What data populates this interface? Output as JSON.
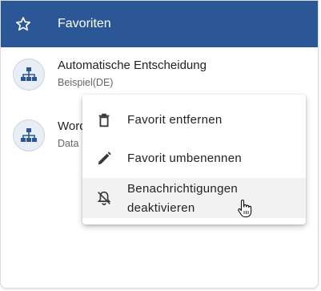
{
  "header": {
    "title": "Favoriten",
    "icon": "star-outline-icon"
  },
  "favorites": [
    {
      "name": "Automatische Entscheidung",
      "subtitle": "Beispiel(DE)",
      "icon": "sitemap-icon"
    },
    {
      "name": "Word",
      "subtitle": "Data",
      "icon": "sitemap-icon"
    }
  ],
  "context_menu": {
    "items": [
      {
        "label": "Favorit entfernen",
        "icon": "trash-icon"
      },
      {
        "label": "Favorit umbenennen",
        "icon": "pencil-icon"
      },
      {
        "label_line1": "Benachrichtigungen",
        "label_line2": "deaktivieren",
        "icon": "bell-off-icon"
      }
    ]
  },
  "colors": {
    "header_bg": "#2c5796",
    "accent_icon": "#2c5796",
    "menu_hover": "#f2f2f2"
  }
}
